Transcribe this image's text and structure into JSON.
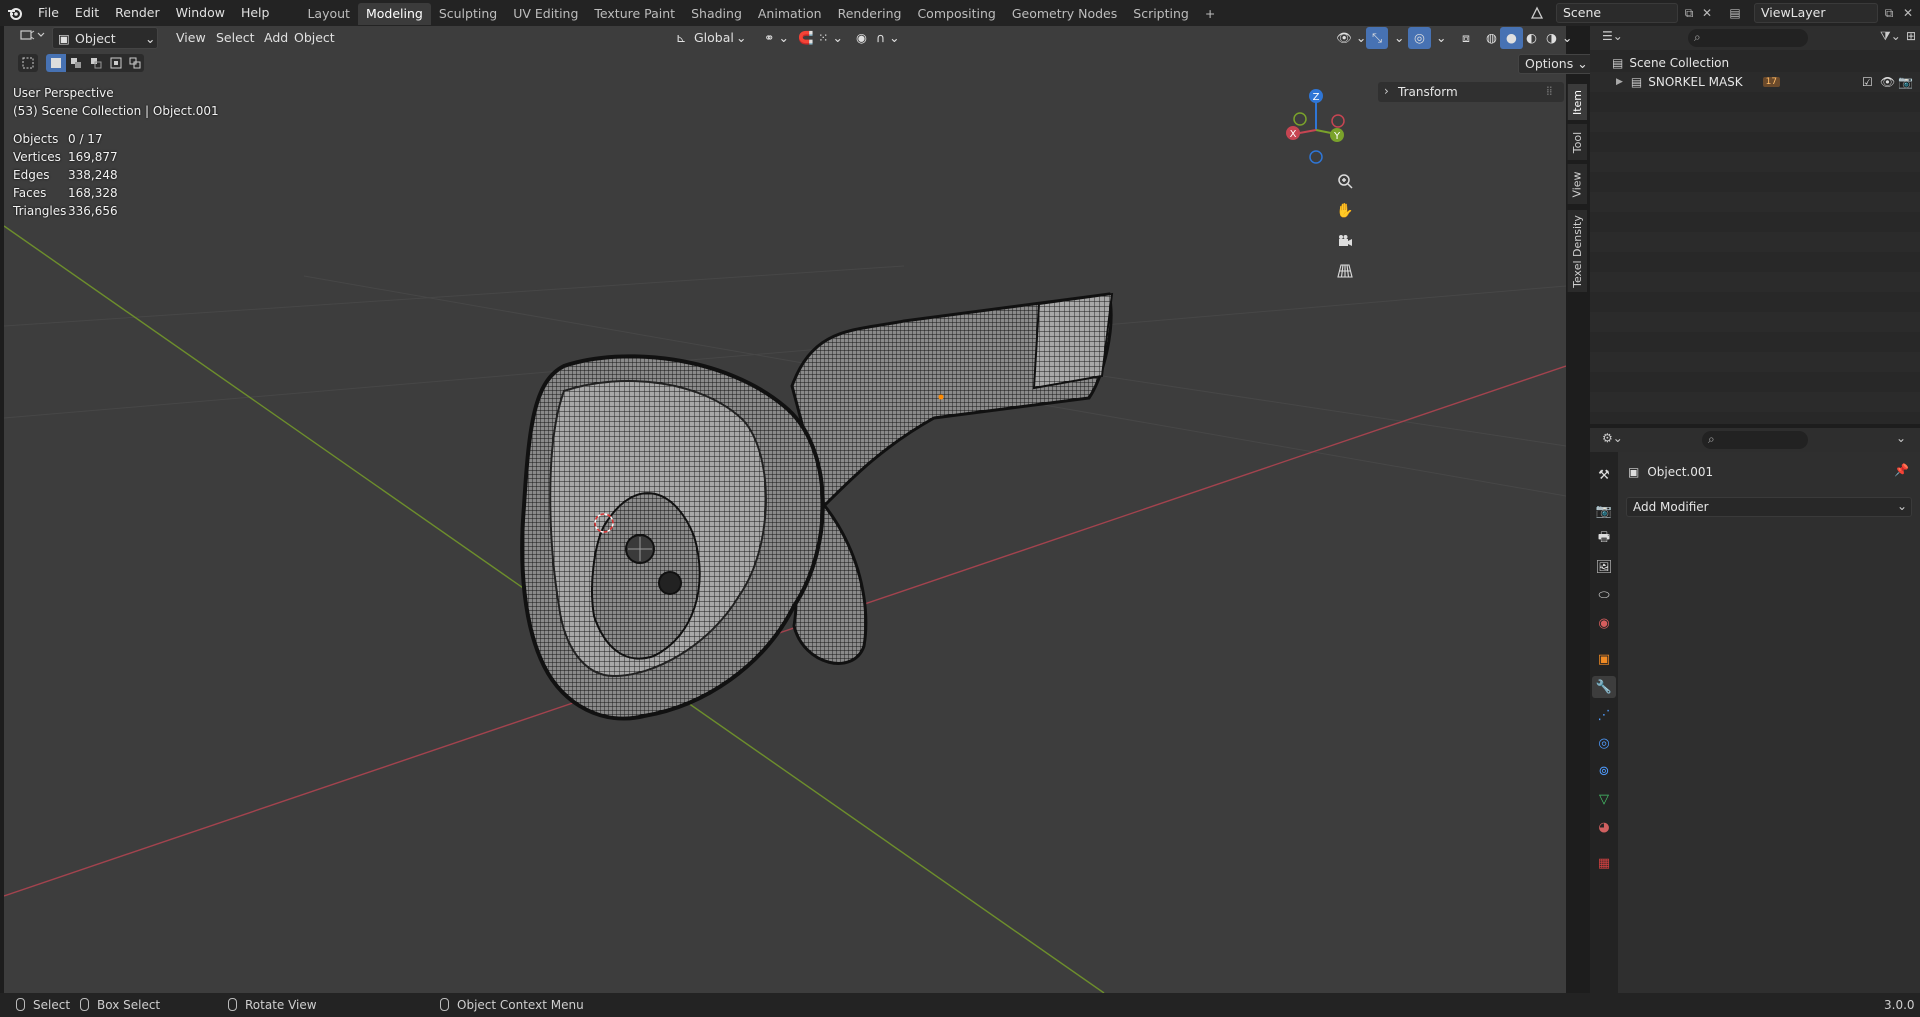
{
  "topbar": {
    "menus": [
      "File",
      "Edit",
      "Render",
      "Window",
      "Help"
    ],
    "workspaces": [
      {
        "label": "Layout",
        "active": false
      },
      {
        "label": "Modeling",
        "active": true
      },
      {
        "label": "Sculpting",
        "active": false
      },
      {
        "label": "UV Editing",
        "active": false
      },
      {
        "label": "Texture Paint",
        "active": false
      },
      {
        "label": "Shading",
        "active": false
      },
      {
        "label": "Animation",
        "active": false
      },
      {
        "label": "Rendering",
        "active": false
      },
      {
        "label": "Compositing",
        "active": false
      },
      {
        "label": "Geometry Nodes",
        "active": false
      },
      {
        "label": "Scripting",
        "active": false
      }
    ],
    "add_tab": "+",
    "scene": "Scene",
    "view_layer": "ViewLayer"
  },
  "viewport_header": {
    "mode": "Object Mode",
    "menus": [
      "View",
      "Select",
      "Add",
      "Object"
    ],
    "transform_orientation": "Global",
    "options": "Options"
  },
  "viewport_overlay": {
    "perspective": "User Perspective",
    "collection": "(53) Scene Collection | Object.001",
    "stats": [
      {
        "label": "Objects",
        "value": "0 / 17"
      },
      {
        "label": "Vertices",
        "value": "169,877"
      },
      {
        "label": "Edges",
        "value": "338,248"
      },
      {
        "label": "Faces",
        "value": "168,328"
      },
      {
        "label": "Triangles",
        "value": "336,656"
      }
    ]
  },
  "gizmo": {
    "x": "X",
    "y": "Y",
    "z": "Z"
  },
  "npanel": {
    "transform": "Transform",
    "tabs": [
      "Item",
      "Tool",
      "View",
      "Texel Density"
    ]
  },
  "outliner": {
    "root": "Scene Collection",
    "items": [
      {
        "label": "SNORKEL MASK",
        "badge": "17"
      }
    ]
  },
  "properties": {
    "object_name": "Object.001",
    "add_modifier": "Add Modifier"
  },
  "statusbar": {
    "select": "Select",
    "box_select": "Box Select",
    "rotate_view": "Rotate View",
    "context_menu": "Object Context Menu",
    "version": "3.0.0"
  },
  "colors": {
    "x_axis": "#c64552",
    "y_axis": "#7aa22b",
    "z_axis": "#2f76d6",
    "accent": "#4772b3"
  }
}
